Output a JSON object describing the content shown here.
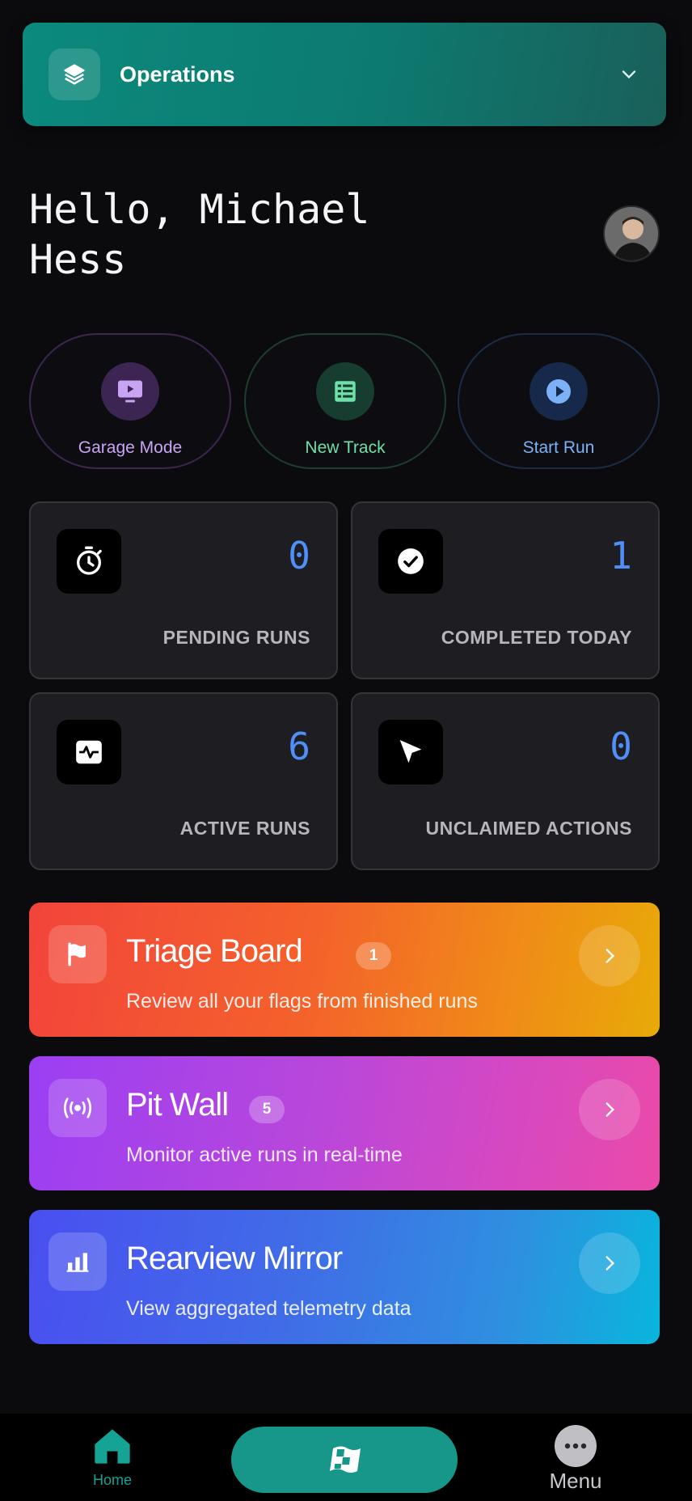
{
  "workspace": {
    "title": "Operations"
  },
  "greeting": {
    "text": "Hello, Michael Hess"
  },
  "quick_actions": [
    {
      "label": "Garage Mode",
      "color": "#c9a4f2",
      "icon": "monitor-play-icon"
    },
    {
      "label": "New Track",
      "color": "#6ee0a8",
      "icon": "spreadsheet-icon"
    },
    {
      "label": "Start Run",
      "color": "#7cb1f7",
      "icon": "play-circle-icon"
    }
  ],
  "stats": [
    {
      "value": "0",
      "label": "PENDING RUNS",
      "icon": "timer-icon"
    },
    {
      "value": "1",
      "label": "COMPLETED TODAY",
      "icon": "check-circle-icon"
    },
    {
      "value": "6",
      "label": "ACTIVE RUNS",
      "icon": "activity-icon"
    },
    {
      "value": "0",
      "label": "UNCLAIMED ACTIONS",
      "icon": "cursor-arrow-icon"
    }
  ],
  "nav_cards": [
    {
      "title": "Triage Board",
      "badge": "1",
      "subtitle": "Review all your flags from finished runs",
      "icon": "flag-icon"
    },
    {
      "title": "Pit Wall",
      "badge": "5",
      "subtitle": "Monitor active runs in real-time",
      "icon": "broadcast-icon"
    },
    {
      "title": "Rearview Mirror",
      "badge": "",
      "subtitle": "View aggregated telemetry data",
      "icon": "bar-chart-icon"
    }
  ],
  "bottom_nav": {
    "home_label": "Home",
    "menu_label": "Menu"
  },
  "colors": {
    "accent": "#14a394",
    "stat_value": "#4f8ff7"
  }
}
